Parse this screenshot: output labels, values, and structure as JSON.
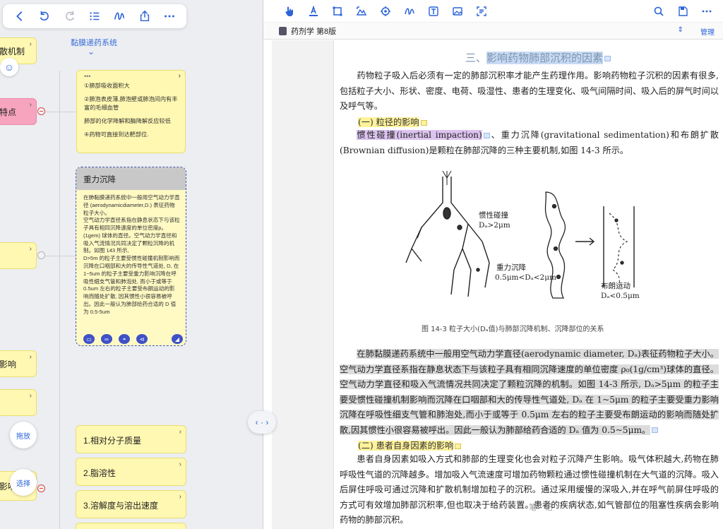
{
  "toolbar_left": {
    "icons": [
      "back-icon",
      "undo-icon",
      "redo-icon",
      "outline-icon",
      "pen-icon",
      "share-icon",
      "more-icon"
    ]
  },
  "mindmap": {
    "center_title": "黏膜递药系统",
    "partial_nodes": [
      {
        "label": "散机制"
      },
      {
        "label": "特点"
      },
      {
        "label": ""
      },
      {
        "label": "影响"
      },
      {
        "label": ""
      },
      {
        "label": "影响"
      }
    ],
    "list_card": {
      "dots": "•••",
      "items": [
        "①肺部吸收面积大",
        "②肺泡表皮薄,肺泡壁或肺泡间内有丰富的毛细血管",
        "肺部的化学降解和酶降解反应较低",
        "④药物可直接到达靶部位."
      ]
    },
    "selected_card": {
      "title": "重力沉降",
      "body": "在肺黏膜递药系统中一般用空气动力学直径 (aerodynamicdiameter,D.) 表征药物粒子大小。\n空气动力学直径系指在静息状态下与该粒子具有相同沉降速度的单位密度p。(1gem) 球体的直径。空气动力学直径和吸入气流情况共同决定了颗粒沉降的机制。如图 143 所示,\nD>5m 的粒子主要受惯性碰撞机制影响而沉降在口咽部和大的传导性气道处, D, 在 1~5um 的粒子主要受重力影响沉降在呼吸性细支气管和肺泡处, 而小于或等于 0.5um 左右的粒子主要受布朗运动的影响而随处扩散, 因其惯性小很容易被呼出。因此一般认为肺部给药合适的 D 值为 0.5-5um"
    },
    "factor_nodes": [
      {
        "label": "1.相对分子质量"
      },
      {
        "label": "2.脂溶性"
      },
      {
        "label": "3.溶解度与溶出速度"
      }
    ],
    "float_buttons": {
      "drag": "拖放",
      "select": "选择"
    }
  },
  "toolbar_right": {
    "icons": [
      "hand-pointer-icon",
      "highlighter-icon",
      "rectangle-select-icon",
      "image-region-icon",
      "lasso-icon",
      "pen-icon",
      "text-box-icon",
      "image-icon",
      "ocr-icon"
    ],
    "right_icons": [
      "search-icon",
      "save-icon",
      "more-icon"
    ]
  },
  "tabbar": {
    "title": "药剂学 第8版",
    "manage": "管理"
  },
  "document": {
    "section_num": "三、",
    "section_title": "影响药物肺部沉积的因素",
    "para1": "药物粒子吸入后必须有一定的肺部沉积率才能产生药理作用。影响药物粒子沉积的因素有很多,包括粒子大小、形状、密度、电荷、吸湿性、患者的生理变化、吸气间隔时间、吸入后的屏气时间以及呼气等。",
    "sub1": "(一) 粒径的影响",
    "p2_hl": "惯性碰撞(inertial impaction)",
    "p2_rest": "、重力沉降(gravitational sedimentation)和布朗扩散(Brownian diffusion)是颗粒在肺部沉降的三种主要机制,如图 14-3 所示。",
    "fig_labels": {
      "impact": "惯性碰撞",
      "impact_range": "Dₐ>2μm",
      "sediment": "重力沉降",
      "sediment_range": "0.5μm<Dₐ<2μm",
      "brownian": "布朗运动",
      "brownian_range": "Dₐ<0.5μm"
    },
    "fig_caption": "图 14-3 粒子大小(Dₐ值)与肺部沉降机制、沉降部位的关系",
    "para3": "在肺黏膜递药系统中一般用空气动力学直径(aerodynamic diameter, Dₐ)表征药物粒子大小。空气动力学直径系指在静息状态下与该粒子具有相同沉降速度的单位密度 ρ₀(1g/cm³)球体的直径。空气动力学直径和吸入气流情况共同决定了颗粒沉降的机制。如图 14-3 所示, Dₐ>5μm 的粒子主要受惯性碰撞机制影响而沉降在口咽部和大的传导性气道处, Dₐ 在 1~5μm 的粒子主要受重力影响沉降在呼吸性细支气管和肺泡处,而小于或等于 0.5μm 左右的粒子主要受布朗运动的影响而随处扩散,因其惯性小很容易被呼出。因此一般认为肺部给药合适的 Dₐ 值为 0.5~5μm。",
    "sub2": "(二) 患者自身因素的影响",
    "para4": "患者自身因素如吸入方式和肺部的生理变化也会对粒子沉降产生影响。吸气体积越大,药物在肺呼吸性气道的沉降越多。增加吸入气流速度可增加药物颗粒通过惯性碰撞机制在大气道的沉降。吸入后屏住呼吸可通过沉降和扩散机制增加粒子的沉积。通过采用缓慢的深吸入,并在呼气前屏住呼吸的方式可有效增加肺部沉积率,但也取决于给药装置。患者的疾病状态,如气管部位的阻塞性疾病会影响药物的肺部沉积。",
    "notes_mark": "笔 记"
  }
}
